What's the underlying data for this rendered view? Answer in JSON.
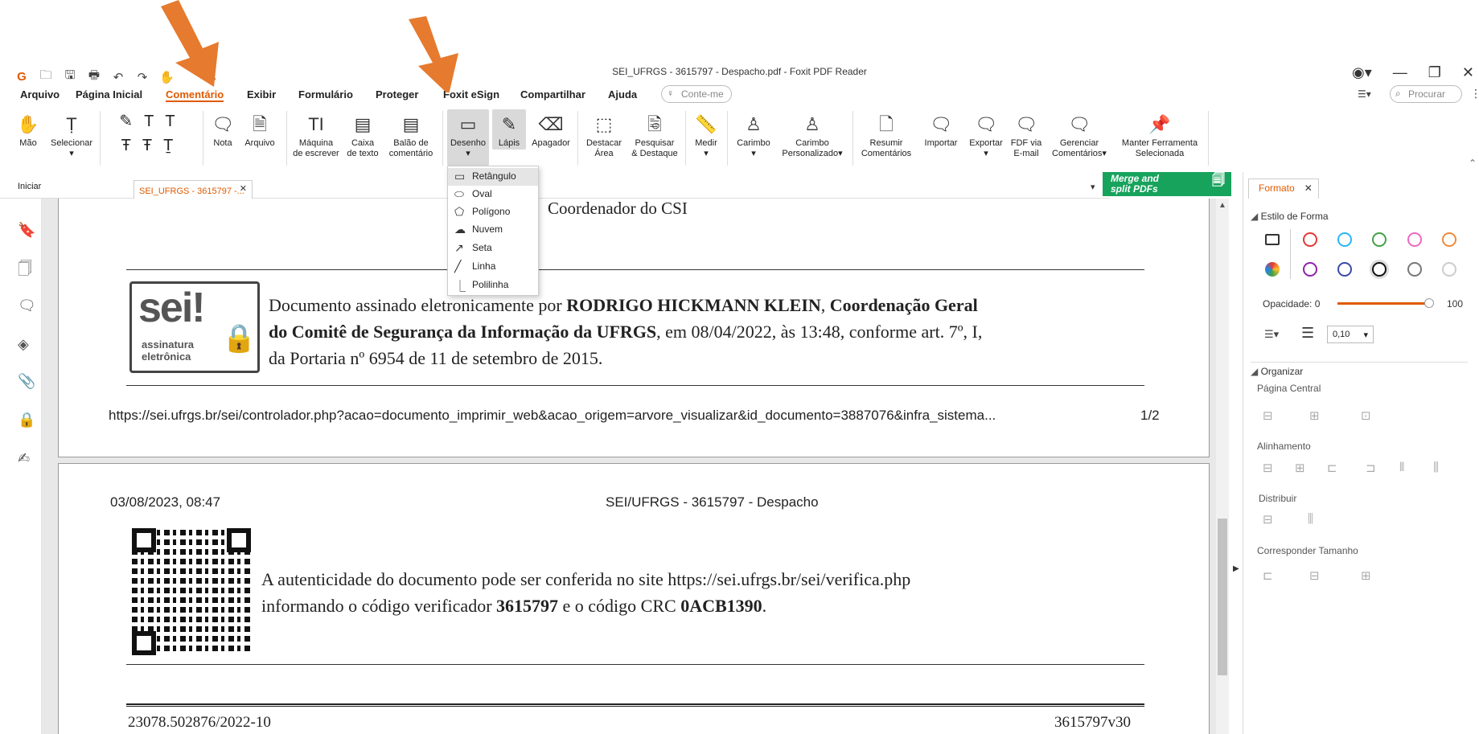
{
  "window": {
    "title": "SEI_UFRGS - 3615797 - Despacho.pdf - Foxit PDF Reader"
  },
  "menu": {
    "items": [
      "Arquivo",
      "Página Inicial",
      "Comentário",
      "Exibir",
      "Formulário",
      "Proteger",
      "Foxit eSign",
      "Compartilhar",
      "Ajuda"
    ],
    "active": "Comentário",
    "tell_me": "Conte-me",
    "search_placeholder": "Procurar"
  },
  "ribbon": {
    "mao": "Mão",
    "selecionar": "Selecionar",
    "nota": "Nota",
    "arquivo": "Arquivo",
    "maquina_1": "Máquina",
    "maquina_2": "de escrever",
    "caixa_1": "Caixa",
    "caixa_2": "de texto",
    "balao_1": "Balão de",
    "balao_2": "comentário",
    "desenho": "Desenho",
    "lapis": "Lápis",
    "apagador": "Apagador",
    "destacar_1": "Destacar",
    "destacar_2": "Área",
    "pesquisar_1": "Pesquisar",
    "pesquisar_2": "& Destaque",
    "medir": "Medir",
    "carimbo": "Carimbo",
    "carimbo_p_1": "Carimbo",
    "carimbo_p_2": "Personalizado",
    "resumir_1": "Resumir",
    "resumir_2": "Comentários",
    "importar": "Importar",
    "exportar": "Exportar",
    "fdf_1": "FDF via",
    "fdf_2": "E-mail",
    "gerenciar_1": "Gerenciar",
    "gerenciar_2": "Comentários",
    "manter_1": "Manter Ferramenta",
    "manter_2": "Selecionada"
  },
  "draw_menu": [
    "Retângulo",
    "Oval",
    "Polígono",
    "Nuvem",
    "Seta",
    "Linha",
    "Polilinha"
  ],
  "tabs": {
    "start": "Iniciar",
    "doc": "SEI_UFRGS - 3615797 -..."
  },
  "ad": {
    "line1": "Merge and",
    "line2": "split PDFs"
  },
  "page1": {
    "heading": "Coordenador do CSI",
    "sig_line1_a": "Documento assinado eletronicamente por ",
    "sig_line1_b": "RODRIGO HICKMANN KLEIN",
    "sig_line1_c": ", ",
    "sig_line1_d": "Coordenação Geral",
    "sig_line2_a": "do Comitê de Segurança da Informação da UFRGS",
    "sig_line2_b": ", em 08/04/2022, às 13:48, conforme art. 7º, I,",
    "sig_line3": "da Portaria nº 6954 de 11 de setembro de 2015.",
    "sei_logo": "sei!",
    "sei_sub1": "assinatura",
    "sei_sub2": "eletrônica",
    "url": "https://sei.ufrgs.br/sei/controlador.php?acao=documento_imprimir_web&acao_origem=arvore_visualizar&id_documento=3887076&infra_sistema...",
    "pagenum": "1/2"
  },
  "page2": {
    "date": "03/08/2023, 08:47",
    "header": "SEI/UFRGS - 3615797 - Despacho",
    "auth_line1": "A autenticidade do documento pode ser conferida no site https://sei.ufrgs.br/sei/verifica.php",
    "auth_line2_a": "informando o código verificador ",
    "auth_line2_b": "3615797",
    "auth_line2_c": " e o código CRC ",
    "auth_line2_d": "0ACB1390",
    "auth_line2_e": ".",
    "footer_left": "23078.502876/2022-10",
    "footer_right": "3615797v30"
  },
  "format_panel": {
    "tab": "Formato",
    "shape_style": "Estilo de Forma",
    "opacity_label": "Opacidade:",
    "opacity_min": "0",
    "opacity_max": "100",
    "line_width": "0,10",
    "organize": "Organizar",
    "center_page": "Página Central",
    "alignment": "Alinhamento",
    "distribute": "Distribuir",
    "match_size": "Corresponder Tamanho"
  },
  "colors": {
    "accent": "#e05a00",
    "arrow": "#e67a2e",
    "ad_green": "#17a35c"
  }
}
